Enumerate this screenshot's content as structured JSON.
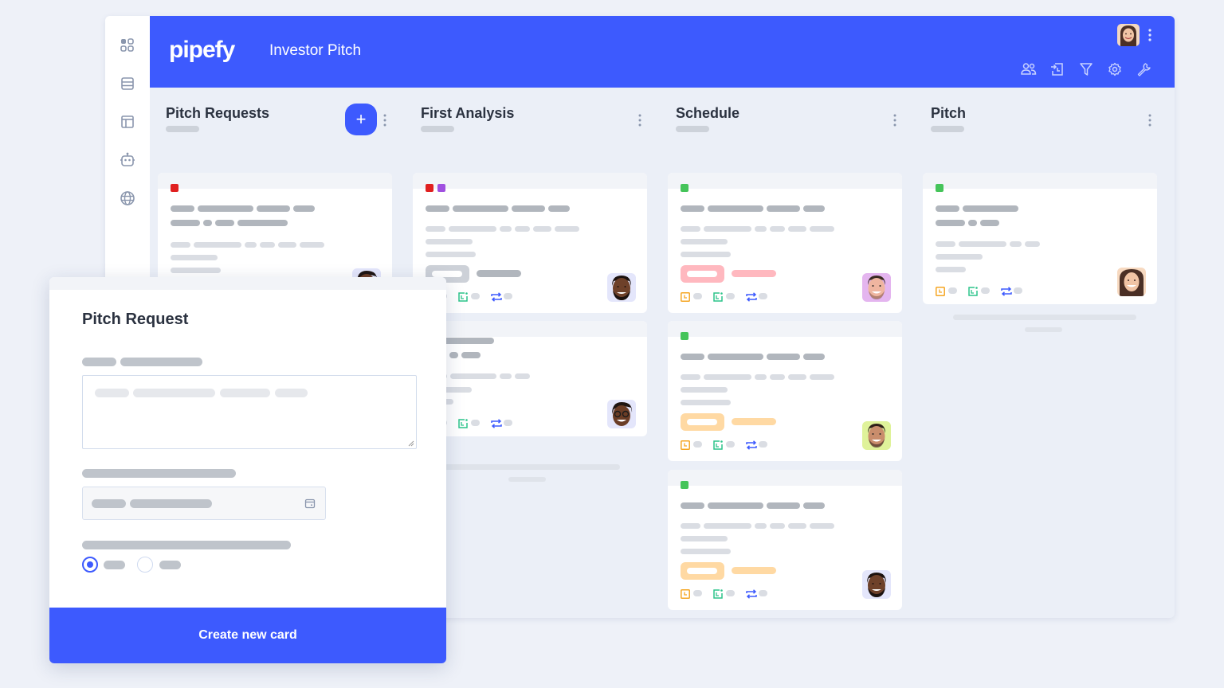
{
  "header": {
    "logo": "pipefy",
    "pipe_title": "Investor Pitch",
    "tools": [
      "members-icon",
      "import-icon",
      "filter-icon",
      "settings-icon",
      "wrench-icon"
    ]
  },
  "sidebar": {
    "items": [
      "apps-grid-icon",
      "database-icon",
      "layout-icon",
      "robot-icon",
      "globe-icon"
    ]
  },
  "colors": {
    "accent": "#3d5afe",
    "label_red": "#e02020",
    "label_purple": "#a050e0",
    "label_green": "#45c45a",
    "tag_pink": "#ffb8bf",
    "tag_orange": "#ffd9a3",
    "tag_gray": "#cdd1d8"
  },
  "phases": [
    {
      "title": "Pitch Requests",
      "add_label": "+"
    },
    {
      "title": "First Analysis"
    },
    {
      "title": "Schedule"
    },
    {
      "title": "Pitch"
    }
  ],
  "modal": {
    "title": "Pitch Request",
    "submit_label": "Create new card"
  }
}
